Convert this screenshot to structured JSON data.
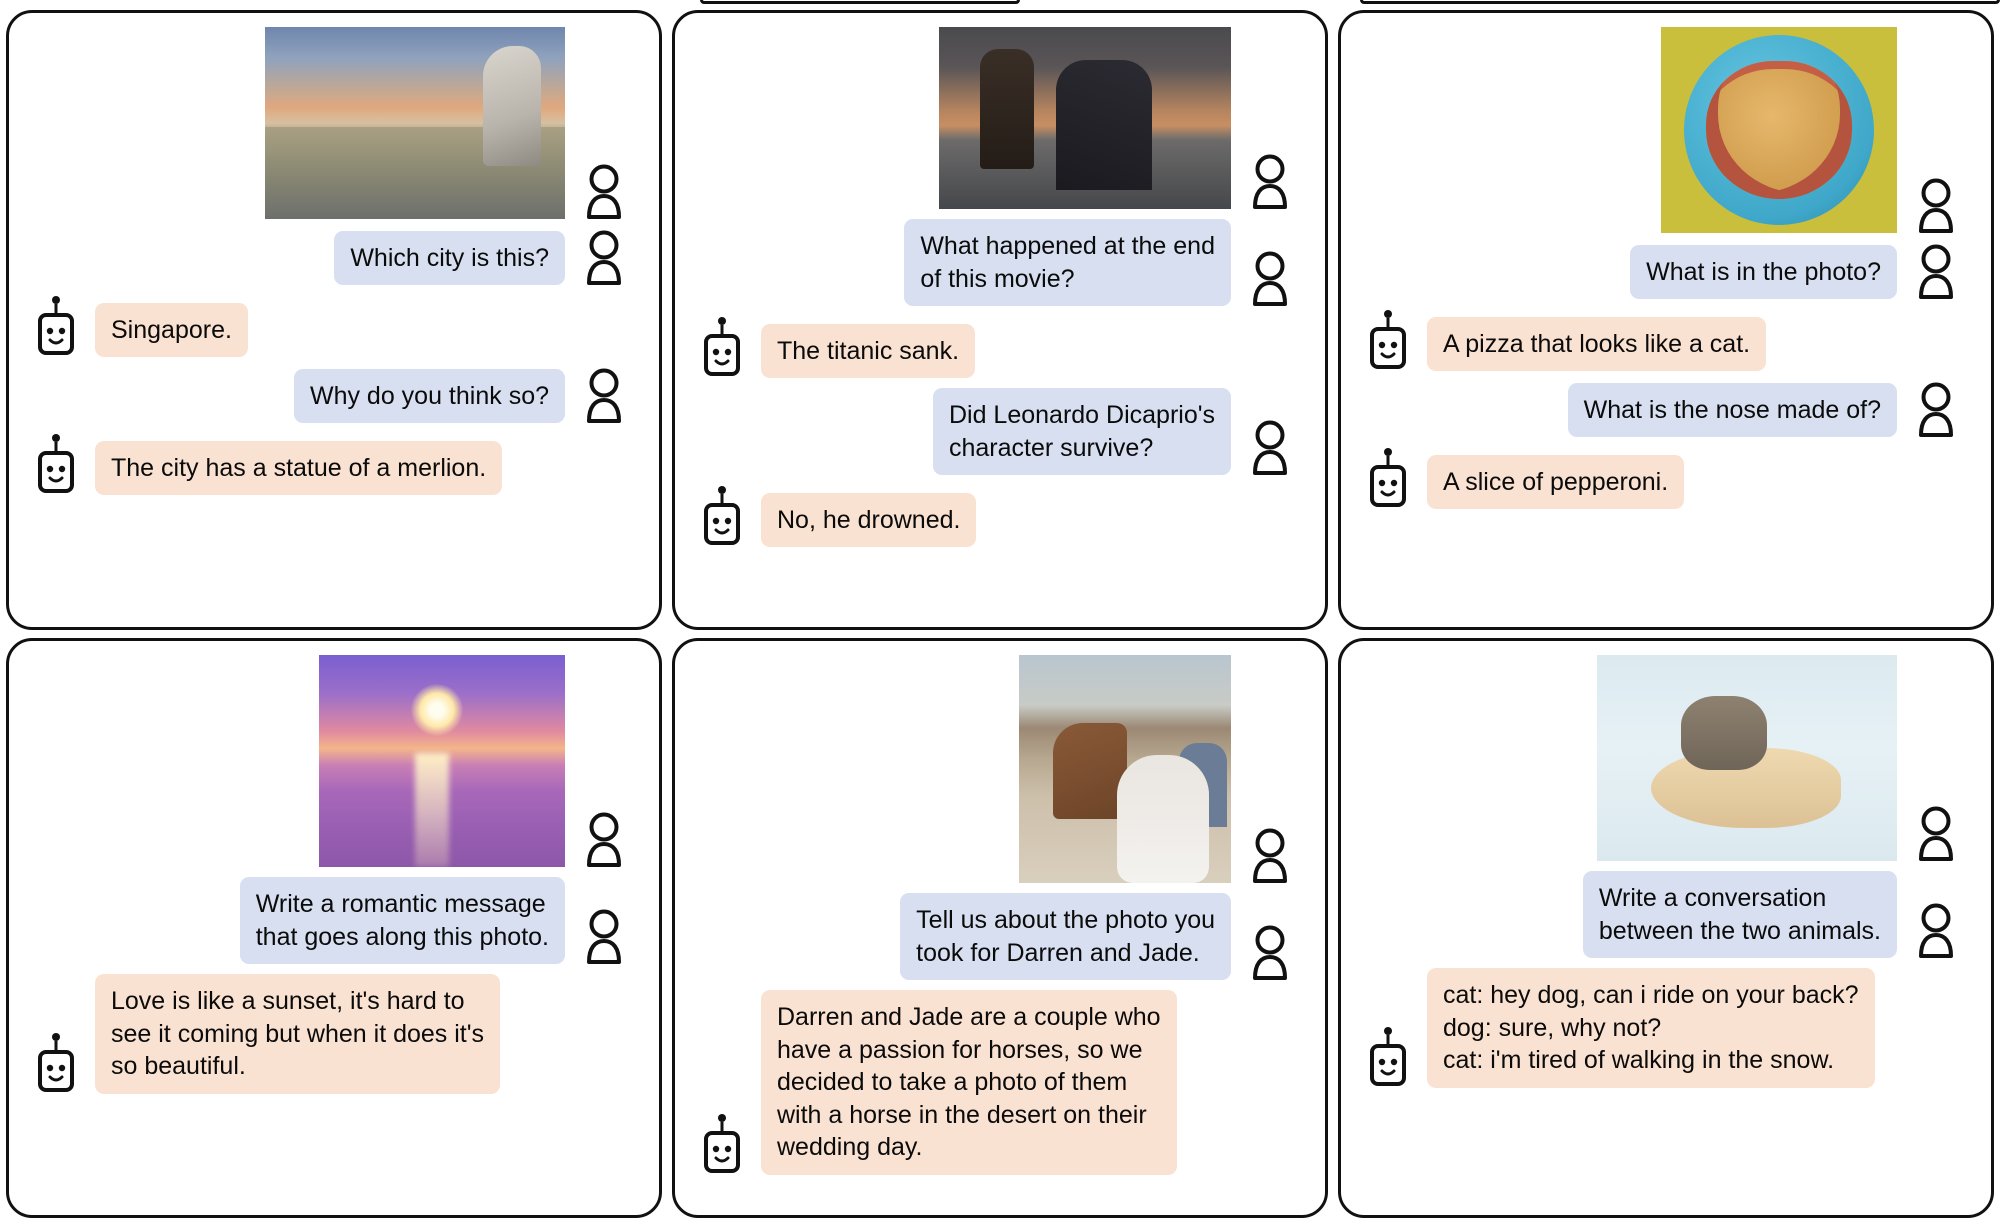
{
  "colors": {
    "user_bubble": "#d7dff0",
    "bot_bubble": "#fae2d2",
    "panel_border": "#111111",
    "text": "#0b0b0b"
  },
  "icons": {
    "user_avatar": "user-avatar-icon",
    "bot_avatar": "robot-avatar-icon"
  },
  "panels": [
    {
      "id": "panel-singapore",
      "photo_alt": "merlion-statue-singapore-skyline-photo",
      "messages": [
        {
          "role": "user",
          "type": "image",
          "text": ""
        },
        {
          "role": "user",
          "type": "text",
          "text": "Which city is this?"
        },
        {
          "role": "bot",
          "type": "text",
          "text": "Singapore."
        },
        {
          "role": "user",
          "type": "text",
          "text": "Why do you think so?"
        },
        {
          "role": "bot",
          "type": "text",
          "text": "The city has a statue of a merlion."
        }
      ]
    },
    {
      "id": "panel-titanic",
      "photo_alt": "titanic-movie-bow-scene-photo",
      "messages": [
        {
          "role": "user",
          "type": "image",
          "text": ""
        },
        {
          "role": "user",
          "type": "text",
          "text": "What happened at the end\nof this movie?"
        },
        {
          "role": "bot",
          "type": "text",
          "text": "The titanic sank."
        },
        {
          "role": "user",
          "type": "text",
          "text": "Did Leonardo Dicaprio's\ncharacter survive?"
        },
        {
          "role": "bot",
          "type": "text",
          "text": "No, he drowned."
        }
      ]
    },
    {
      "id": "panel-pizza-cat",
      "photo_alt": "cat-shaped-pizza-on-blue-plate-photo",
      "messages": [
        {
          "role": "user",
          "type": "image",
          "text": ""
        },
        {
          "role": "user",
          "type": "text",
          "text": "What is in the photo?"
        },
        {
          "role": "bot",
          "type": "text",
          "text": "A pizza that looks like a cat."
        },
        {
          "role": "user",
          "type": "text",
          "text": "What is the nose made of?"
        },
        {
          "role": "bot",
          "type": "text",
          "text": "A slice of pepperoni."
        }
      ]
    },
    {
      "id": "panel-sunset",
      "photo_alt": "purple-ocean-sunset-photo",
      "messages": [
        {
          "role": "user",
          "type": "image",
          "text": ""
        },
        {
          "role": "user",
          "type": "text",
          "text": "Write a romantic message\nthat goes along this photo."
        },
        {
          "role": "bot",
          "type": "text",
          "text": "Love is like a sunset, it's hard to\nsee it coming but when it does it's\nso beautiful."
        }
      ]
    },
    {
      "id": "panel-wedding",
      "photo_alt": "desert-wedding-couple-with-horse-photo",
      "messages": [
        {
          "role": "user",
          "type": "image",
          "text": ""
        },
        {
          "role": "user",
          "type": "text",
          "text": "Tell us about the photo you\ntook for Darren and Jade."
        },
        {
          "role": "bot",
          "type": "text",
          "text": "Darren and Jade are a couple who\nhave a passion for horses, so we\ndecided to take a photo of them\nwith a horse in the desert on their\nwedding day."
        }
      ]
    },
    {
      "id": "panel-cat-dog",
      "photo_alt": "cat-riding-on-dog-in-snow-photo",
      "messages": [
        {
          "role": "user",
          "type": "image",
          "text": ""
        },
        {
          "role": "user",
          "type": "text",
          "text": "Write a conversation\nbetween the two animals."
        },
        {
          "role": "bot",
          "type": "text",
          "text": "cat: hey dog, can i ride on your back?\ndog: sure, why not?\ncat: i'm tired of walking in the snow."
        }
      ]
    }
  ]
}
